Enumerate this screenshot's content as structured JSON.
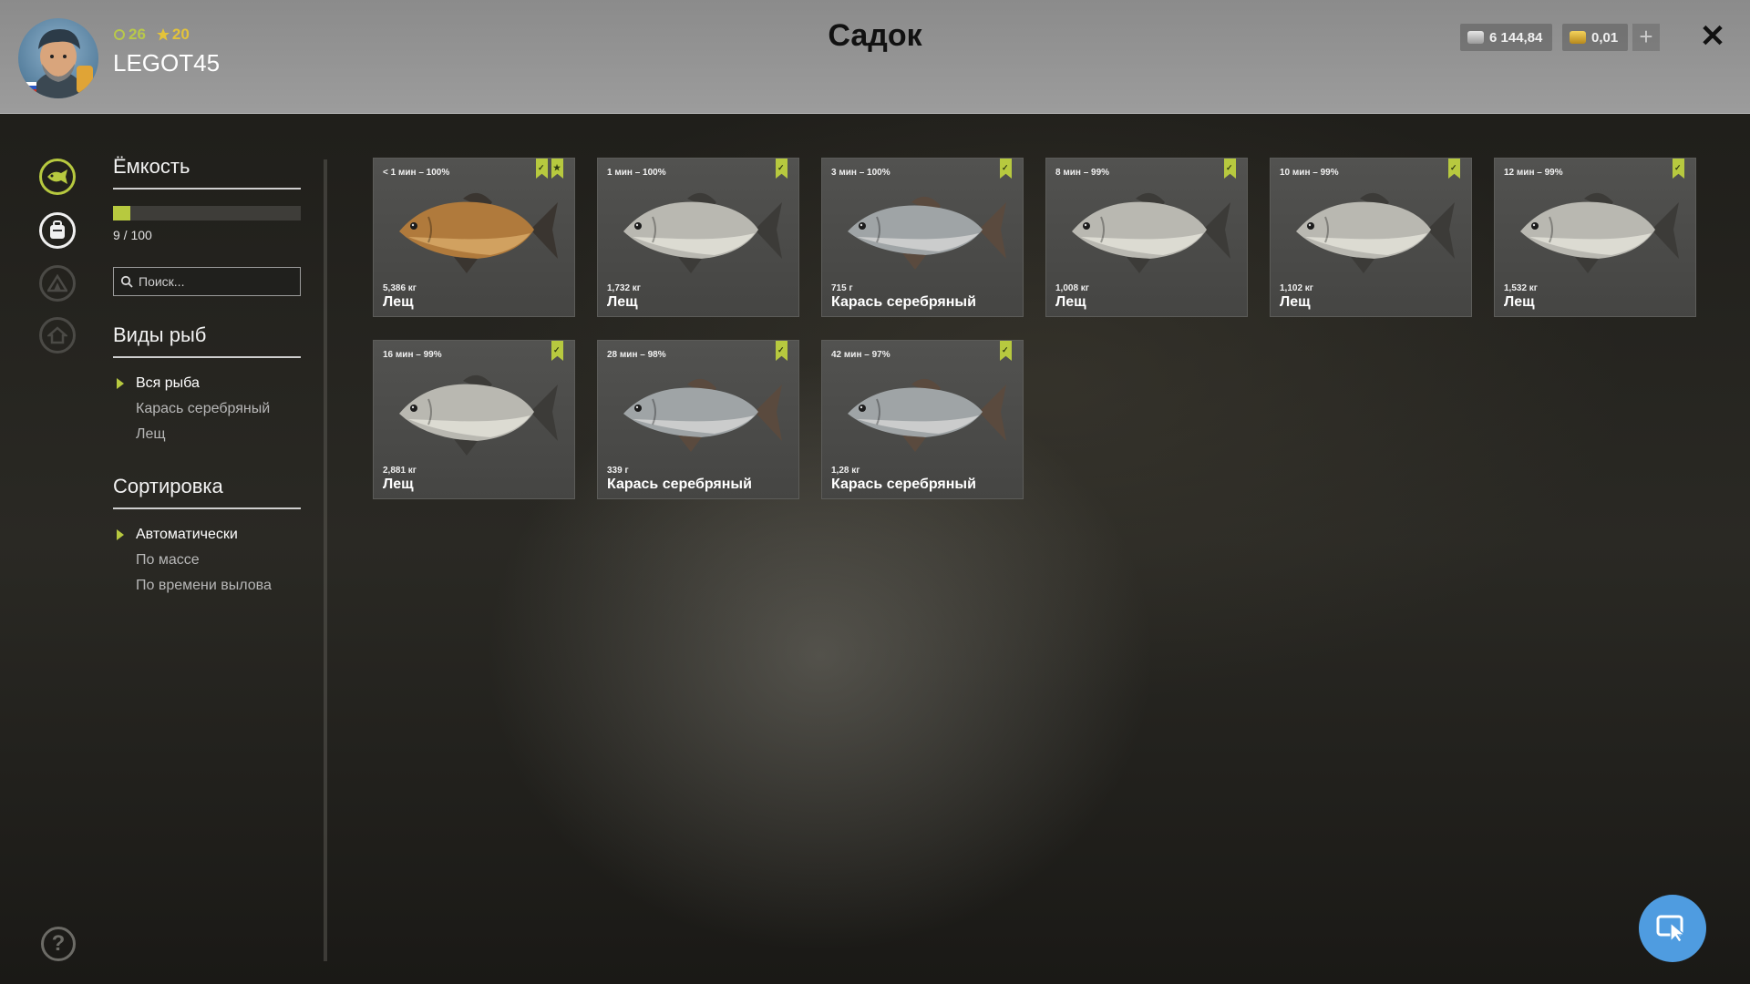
{
  "header": {
    "title": "Садок",
    "username": "LEGOT45",
    "level": "26",
    "rank": "20",
    "silver": "6 144,84",
    "gold": "0,01",
    "add_label": "+",
    "close_label": "✕"
  },
  "sidebar": {
    "capacity_title": "Ёмкость",
    "capacity_text": "9 / 100",
    "capacity_fraction": 0.09,
    "search_placeholder": "Поиск...",
    "species_title": "Виды рыб",
    "species": [
      {
        "label": "Вся рыба",
        "selected": true
      },
      {
        "label": "Карась серебряный",
        "selected": false
      },
      {
        "label": "Лещ",
        "selected": false
      }
    ],
    "sort_title": "Сортировка",
    "sort_options": [
      {
        "label": "Автоматически",
        "selected": true
      },
      {
        "label": "По массе",
        "selected": false
      },
      {
        "label": "По времени вылова",
        "selected": false
      }
    ]
  },
  "fish": [
    {
      "time": "< 1 мин – 100%",
      "weight": "5,386 кг",
      "species": "Лещ",
      "kind": "bream-gold",
      "starred": true
    },
    {
      "time": "1 мин – 100%",
      "weight": "1,732 кг",
      "species": "Лещ",
      "kind": "bream",
      "starred": false
    },
    {
      "time": "3 мин – 100%",
      "weight": "715 г",
      "species": "Карась серебряный",
      "kind": "carp",
      "starred": false
    },
    {
      "time": "8 мин – 99%",
      "weight": "1,008 кг",
      "species": "Лещ",
      "kind": "bream",
      "starred": false
    },
    {
      "time": "10 мин – 99%",
      "weight": "1,102 кг",
      "species": "Лещ",
      "kind": "bream",
      "starred": false
    },
    {
      "time": "12 мин – 99%",
      "weight": "1,532 кг",
      "species": "Лещ",
      "kind": "bream",
      "starred": false
    },
    {
      "time": "16 мин – 99%",
      "weight": "2,881 кг",
      "species": "Лещ",
      "kind": "bream",
      "starred": false
    },
    {
      "time": "28 мин – 98%",
      "weight": "339 г",
      "species": "Карась серебряный",
      "kind": "carp",
      "starred": false
    },
    {
      "time": "42 мин – 97%",
      "weight": "1,28 кг",
      "species": "Карась серебряный",
      "kind": "carp",
      "starred": false
    }
  ],
  "colors": {
    "accent": "#b7c93f",
    "cursor_button": "#4f9ce0"
  }
}
